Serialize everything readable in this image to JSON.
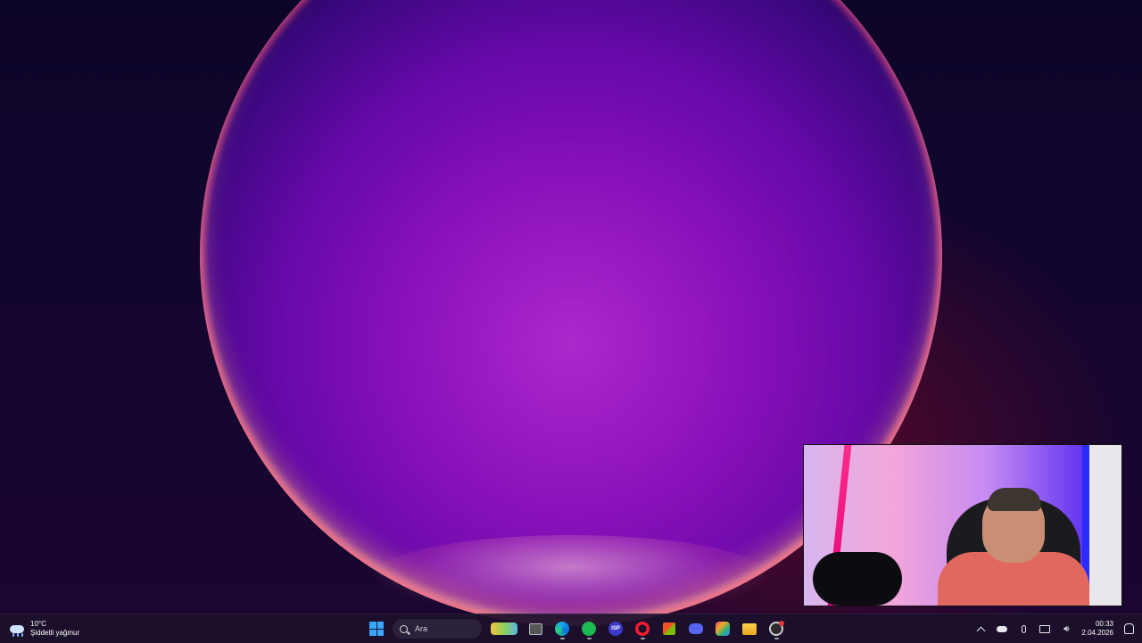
{
  "weather": {
    "temperature": "10°C",
    "condition": "Şiddetli yağmur",
    "icon": "rain-cloud-icon"
  },
  "search": {
    "placeholder": "Ara"
  },
  "taskbar": {
    "pinned_apps": [
      "widgets-icon",
      "task-view-icon",
      "edge-icon",
      "spotify-icon",
      "isp-icon",
      "opera-icon",
      "store-icon",
      "discord-icon",
      "copilot-icon",
      "file-explorer-icon",
      "obs-icon"
    ]
  },
  "tray": {
    "time": "00:33",
    "date": "2.04.2026"
  },
  "colors": {
    "taskbar_bg": "#1c102c",
    "accent": "#3aa7ff"
  }
}
